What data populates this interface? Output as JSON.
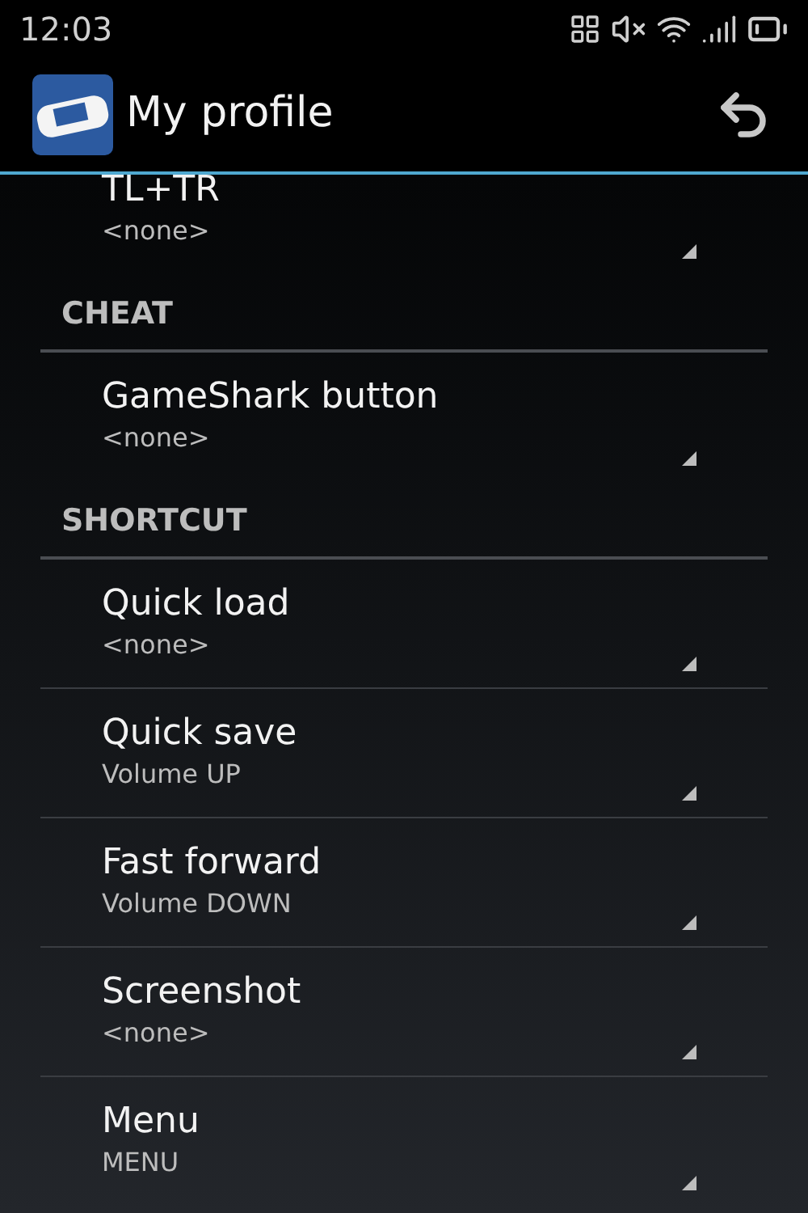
{
  "status_bar": {
    "time": "12:03"
  },
  "action_bar": {
    "title": "My profile"
  },
  "items": [
    {
      "kind": "pref",
      "title": "TL+TR",
      "summary": "<none>"
    },
    {
      "kind": "section",
      "title": "CHEAT"
    },
    {
      "kind": "pref",
      "title": "GameShark button",
      "summary": "<none>"
    },
    {
      "kind": "section",
      "title": "SHORTCUT"
    },
    {
      "kind": "pref",
      "title": "Quick load",
      "summary": "<none>"
    },
    {
      "kind": "pref",
      "title": "Quick save",
      "summary": "Volume UP"
    },
    {
      "kind": "pref",
      "title": "Fast forward",
      "summary": "Volume DOWN"
    },
    {
      "kind": "pref",
      "title": "Screenshot",
      "summary": "<none>"
    },
    {
      "kind": "pref",
      "title": "Menu",
      "summary": "MENU"
    }
  ]
}
